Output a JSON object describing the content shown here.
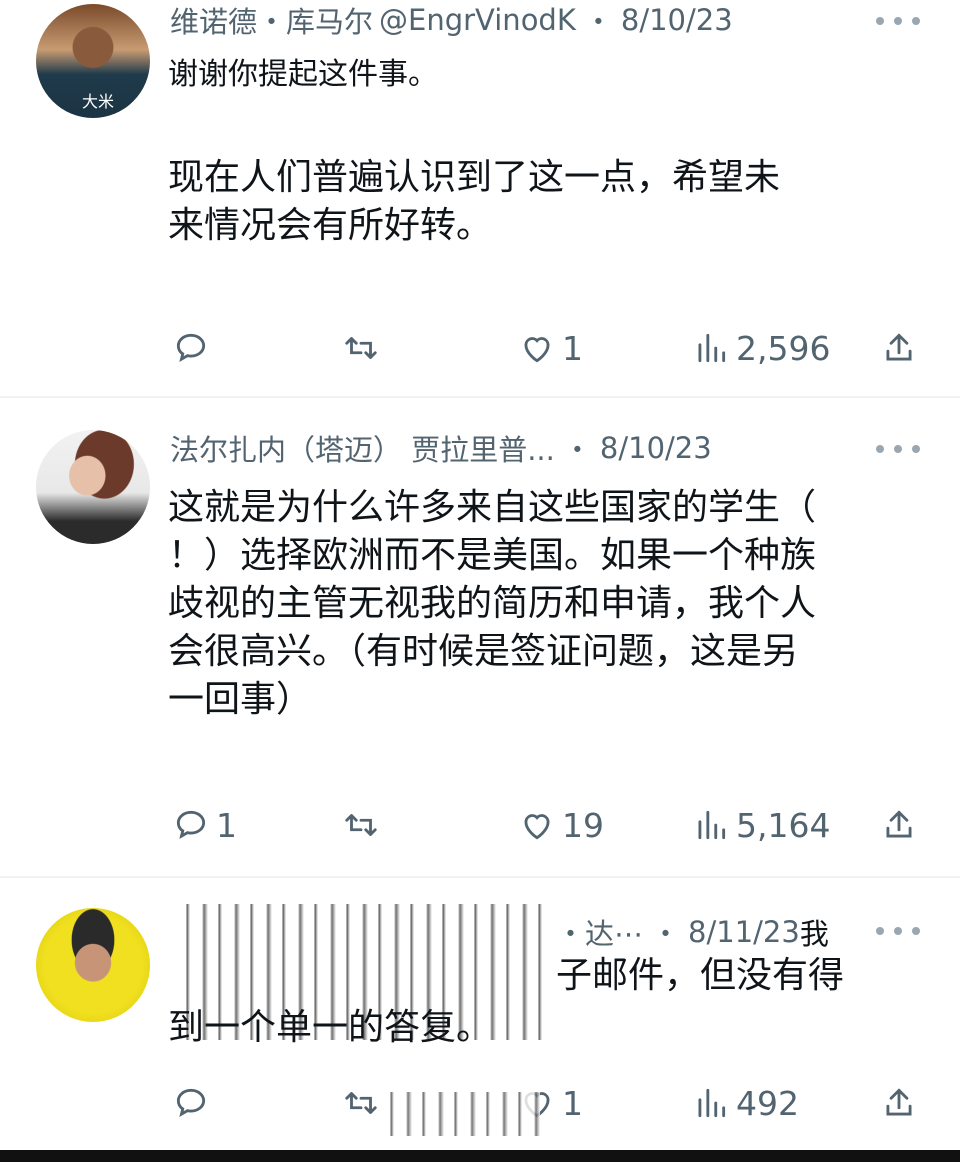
{
  "tweets": [
    {
      "name": "维诺德・库马尔",
      "handle": "@EngrVinodK",
      "dot": "・",
      "date": "8/10/23",
      "avatar_text": "大米",
      "line1": "谢谢你提起这件事。",
      "line2": "现在人们普遍认识到了这一点，希望未",
      "line3": "来情况会有所好转。",
      "replies": "",
      "reposts": "",
      "likes": "1",
      "views": "2,596"
    },
    {
      "name": "法尔扎内（塔迈） 贾拉里普...",
      "dot": "・",
      "date": "8/10/23",
      "line1": "这就是为什么许多来自这些国家的学生（",
      "line2": "！）选择欧洲而不是美国。如果一个种族",
      "line3": "歧视的主管无视我的简历和申请，我个人",
      "line4": "会很高兴。（有时候是签证问题，这是另",
      "line5": "一回事）",
      "replies": "1",
      "reposts": "",
      "likes": "19",
      "views": "5,164"
    },
    {
      "name_fragment": "・达⋯",
      "dot": "・",
      "date": "8/11/23",
      "overflow_text": "我",
      "line1": "子邮件，但没有得",
      "line2": "到一个单一的答复。",
      "replies": "",
      "reposts": "",
      "likes": "1",
      "views": "492"
    }
  ],
  "colors": {
    "text": "#0f1419",
    "muted": "#536471",
    "divider": "#eff3f4"
  },
  "icons": [
    "reply-icon",
    "repost-icon",
    "like-icon",
    "views-icon",
    "share-icon",
    "more-icon"
  ]
}
